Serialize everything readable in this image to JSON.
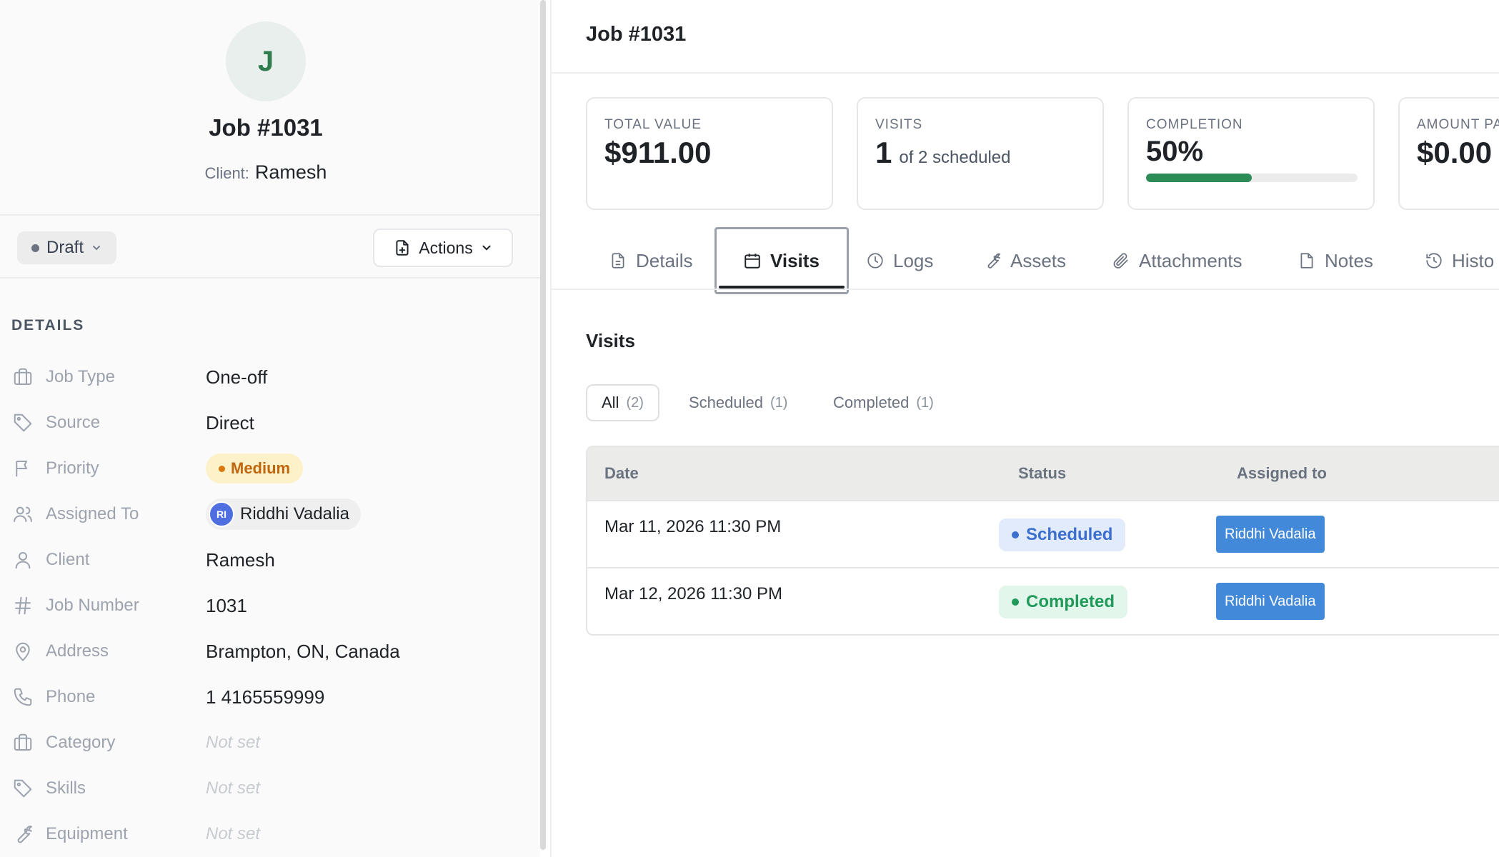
{
  "profile": {
    "initial": "J",
    "title": "Job #1031",
    "client_label": "Client:",
    "client_name": "Ramesh"
  },
  "toolbar": {
    "status_label": "Draft",
    "actions_label": "Actions"
  },
  "details": {
    "section_label": "DETAILS",
    "rows": [
      {
        "key": "Job Type",
        "value": "One-off",
        "icon": "briefcase-icon"
      },
      {
        "key": "Source",
        "value": "Direct",
        "icon": "tag-icon"
      },
      {
        "key": "Priority",
        "value": "Medium",
        "icon": "flag-icon"
      },
      {
        "key": "Assigned To",
        "value": "Riddhi Vadalia",
        "initials": "RI",
        "icon": "users-icon"
      },
      {
        "key": "Client",
        "value": "Ramesh",
        "icon": "user-icon"
      },
      {
        "key": "Job Number",
        "value": "1031",
        "icon": "hash-icon"
      },
      {
        "key": "Address",
        "value": "Brampton, ON, Canada",
        "icon": "map-pin-icon"
      },
      {
        "key": "Phone",
        "value": "1 4165559999",
        "icon": "phone-icon"
      },
      {
        "key": "Category",
        "value": "Not set",
        "icon": "briefcase-icon"
      },
      {
        "key": "Skills",
        "value": "Not set",
        "icon": "tag-icon"
      },
      {
        "key": "Equipment",
        "value": "Not set",
        "icon": "wrench-icon"
      }
    ]
  },
  "header": {
    "title": "Job #1031"
  },
  "stats": {
    "total_value": {
      "label": "TOTAL VALUE",
      "value": "$911.00"
    },
    "visits": {
      "label": "VISITS",
      "value": "1",
      "suffix": "of 2 scheduled"
    },
    "completion": {
      "label": "COMPLETION",
      "value": "50%",
      "progress": 0.5
    },
    "amount_paid": {
      "label": "AMOUNT PA",
      "value": "$0.00"
    }
  },
  "tabs": [
    {
      "label": "Details",
      "icon": "document-icon"
    },
    {
      "label": "Visits",
      "icon": "calendar-icon",
      "active": true
    },
    {
      "label": "Logs",
      "icon": "clock-icon"
    },
    {
      "label": "Assets",
      "icon": "wrench-icon"
    },
    {
      "label": "Attachments",
      "icon": "paperclip-icon"
    },
    {
      "label": "Notes",
      "icon": "note-icon"
    },
    {
      "label": "Histo",
      "icon": "history-icon"
    }
  ],
  "visits": {
    "title": "Visits",
    "filters": [
      {
        "label": "All",
        "count": "(2)",
        "active": true
      },
      {
        "label": "Scheduled",
        "count": "(1)"
      },
      {
        "label": "Completed",
        "count": "(1)"
      }
    ],
    "columns": [
      "Date",
      "Status",
      "Assigned to"
    ],
    "rows": [
      {
        "date": "Mar 11, 2026 11:30 PM",
        "status": "Scheduled",
        "assignee": "Riddhi Vadalia"
      },
      {
        "date": "Mar 12, 2026 11:30 PM",
        "status": "Completed",
        "assignee": "Riddhi Vadalia"
      }
    ]
  },
  "colors": {
    "accent_green": "#2b8c58",
    "scheduled_blue": "#3b6fcf",
    "completed_green": "#1f9a5b",
    "assignee_blue": "#4389d9",
    "priority_orange": "#c0660e"
  }
}
